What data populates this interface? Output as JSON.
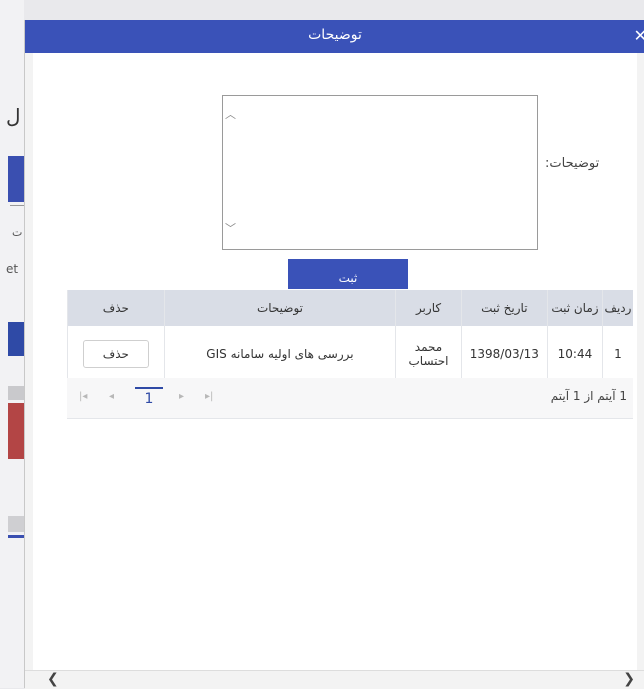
{
  "background": {
    "letter": "ل",
    "text1": "ت",
    "text2": "et"
  },
  "dialog": {
    "title": "توضیحات",
    "close_icon": "✕"
  },
  "form": {
    "description_label": "توضیحات:",
    "description_value": "",
    "submit_label": "ثبت"
  },
  "table": {
    "headers": {
      "row": "ردیف",
      "time": "زمان ثبت",
      "date": "تاریخ ثبت",
      "user": "کاربر",
      "description": "توضیحات",
      "delete": "حذف"
    },
    "rows": [
      {
        "row": "1",
        "time": "10:44",
        "date": "1398/03/13",
        "user": "محمد احتساب",
        "description": "بررسی های اولیه سامانه GIS",
        "delete_label": "حذف"
      }
    ]
  },
  "pager": {
    "current_page": "1",
    "info": "1 آیتم از 1 آیتم"
  },
  "colors": {
    "accent": "#3a52b8",
    "header_bg": "#d9dde6"
  }
}
